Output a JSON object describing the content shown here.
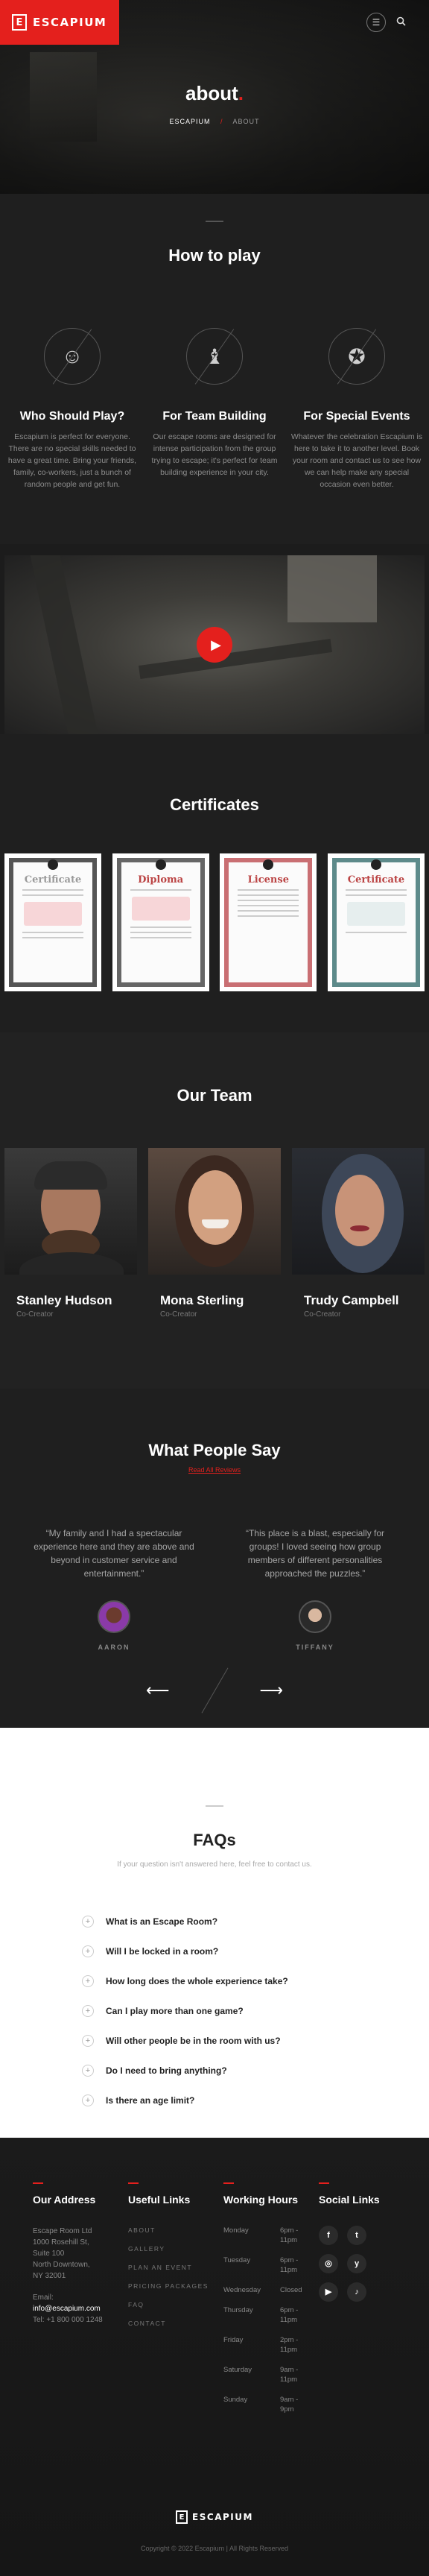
{
  "header": {
    "logo_mark": "E",
    "logo_text": "ESCAPIUM",
    "menu_icon": "☰",
    "search_icon": "🔍",
    "accent_color": "#e4201d"
  },
  "hero": {
    "title": "about",
    "title_dot": ".",
    "breadcrumb_home": "ESCAPIUM",
    "breadcrumb_sep": "/",
    "breadcrumb_current": "ABOUT"
  },
  "howto": {
    "title": "How to play",
    "cards": [
      {
        "icon": "person-icon",
        "glyph": "☺",
        "title": "Who Should Play?",
        "text": "Escapium is perfect for everyone. There are no special skills needed to have a great time. Bring your friends, family, co-workers, just a bunch of random people and get fun."
      },
      {
        "icon": "chess-piece-icon",
        "glyph": "♝",
        "title": "For Team Building",
        "text": "Our escape rooms are designed for intense participation from the group trying to escape; it's perfect for team building experience in your city."
      },
      {
        "icon": "award-icon",
        "glyph": "✪",
        "title": "For Special Events",
        "text": "Whatever the celebration Escapium is here to take it to another level. Book your room and contact us to see how we can help make any special occasion even better."
      }
    ]
  },
  "video": {
    "play_icon": "▶"
  },
  "certificates": {
    "title": "Certificates",
    "items": [
      {
        "title": "Certificate",
        "border": "#555555"
      },
      {
        "title": "Diploma",
        "border": "#666666"
      },
      {
        "title": "License",
        "border": "#c96f73"
      },
      {
        "title": "Certificate",
        "border": "#5d8a8a"
      }
    ]
  },
  "team": {
    "title": "Our Team",
    "members": [
      {
        "name": "Stanley Hudson",
        "role": "Co-Creator"
      },
      {
        "name": "Mona Sterling",
        "role": "Co-Creator"
      },
      {
        "name": "Trudy Campbell",
        "role": "Co-Creator"
      }
    ]
  },
  "reviews": {
    "title": "What People Say",
    "link": "Read All Reviews",
    "items": [
      {
        "text": "“My family and I had a spectacular experience here and they are above and beyond in customer service and entertainment.”",
        "name": "AARON"
      },
      {
        "text": "“This place is a blast, especially for groups! I loved seeing how group members of different personalities approached the puzzles.”",
        "name": "TIFFANY"
      }
    ],
    "prev_icon": "⟵",
    "next_icon": "⟶"
  },
  "faq": {
    "title": "FAQs",
    "subtitle": "If your question isn't answered here, feel free to contact us.",
    "questions": [
      "What is an Escape Room?",
      "Will I be locked in a room?",
      "How long does the whole experience take?",
      "Can I play more than one game?",
      "Will other people be in the room with us?",
      "Do I need to bring anything?",
      "Is there an age limit?"
    ]
  },
  "footer": {
    "address_title": "Our Address",
    "address_lines": [
      "Escape Room Ltd",
      "1000 Rosehill St,",
      "Suite 100",
      "North Downtown,",
      "NY 32001"
    ],
    "email_label": "Email:",
    "email": "info@escapium.com",
    "phone": "Tel: +1 800 000 1248",
    "links_title": "Useful Links",
    "links": [
      "ABOUT",
      "GALLERY",
      "PLAN AN EVENT",
      "PRICING PACKAGES",
      "FAQ",
      "CONTACT"
    ],
    "hours_title": "Working Hours",
    "hours": [
      {
        "day": "Monday",
        "time": "6pm - 11pm"
      },
      {
        "day": "Tuesday",
        "time": "6pm - 11pm"
      },
      {
        "day": "Wednesday",
        "time": "Closed"
      },
      {
        "day": "Thursday",
        "time": "6pm - 11pm"
      },
      {
        "day": "Friday",
        "time": "2pm - 11pm"
      },
      {
        "day": "Saturday",
        "time": "9am - 11pm"
      },
      {
        "day": "Sunday",
        "time": "9am - 9pm"
      }
    ],
    "social_title": "Social Links",
    "social": [
      {
        "name": "facebook-icon",
        "glyph": "f"
      },
      {
        "name": "twitter-icon",
        "glyph": "t"
      },
      {
        "name": "instagram-icon",
        "glyph": "◎"
      },
      {
        "name": "yelp-icon",
        "glyph": "y"
      },
      {
        "name": "youtube-icon",
        "glyph": "▶"
      },
      {
        "name": "tiktok-icon",
        "glyph": "♪"
      }
    ],
    "logo_text": "ESCAPIUM",
    "logo_mark": "E",
    "copyright": "Copyright © 2022 Escapium | All Rights Reserved"
  }
}
